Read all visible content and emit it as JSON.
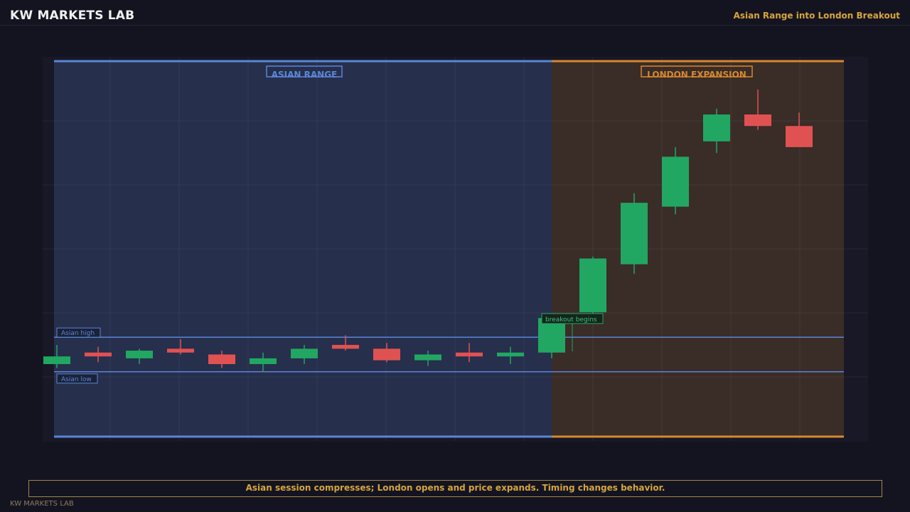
{
  "header": {
    "brand": "KW MARKETS LAB",
    "subtitle": "Asian Range into London Breakout"
  },
  "caption": "Asian session compresses; London opens and price expands. Timing changes behavior.",
  "footer": "KW MARKETS LAB",
  "colors": {
    "background": "#141421",
    "up": "#22a762",
    "down": "#e05252",
    "asian": "#5b86d6",
    "london": "#d6882e",
    "accent_text": "#d6a63c"
  },
  "chart_data": {
    "type": "candlestick",
    "title": "",
    "xlabel": "",
    "ylabel": "",
    "ylim": [
      0,
      10
    ],
    "grid": true,
    "zones": [
      {
        "name": "asian",
        "label": "ASIAN RANGE",
        "start": 0,
        "end": 12
      },
      {
        "name": "london",
        "label": "LONDON EXPANSION",
        "start": 12,
        "end": 19
      }
    ],
    "levels": [
      {
        "name": "asian-high",
        "label": "Asian high",
        "value": 2.7
      },
      {
        "name": "asian-low",
        "label": "Asian low",
        "value": 1.8
      }
    ],
    "annotations": [
      {
        "name": "breakout-label",
        "text": "breakout begins",
        "x": 13
      }
    ],
    "candles": [
      {
        "o": 2.0,
        "h": 2.5,
        "l": 1.9,
        "c": 2.2
      },
      {
        "o": 2.3,
        "h": 2.45,
        "l": 2.05,
        "c": 2.2
      },
      {
        "o": 2.15,
        "h": 2.4,
        "l": 2.0,
        "c": 2.35
      },
      {
        "o": 2.4,
        "h": 2.65,
        "l": 2.25,
        "c": 2.3
      },
      {
        "o": 2.25,
        "h": 2.35,
        "l": 1.9,
        "c": 2.0
      },
      {
        "o": 2.0,
        "h": 2.3,
        "l": 1.8,
        "c": 2.15
      },
      {
        "o": 2.15,
        "h": 2.5,
        "l": 2.0,
        "c": 2.4
      },
      {
        "o": 2.5,
        "h": 2.75,
        "l": 2.35,
        "c": 2.4
      },
      {
        "o": 2.4,
        "h": 2.55,
        "l": 2.05,
        "c": 2.1
      },
      {
        "o": 2.1,
        "h": 2.35,
        "l": 1.95,
        "c": 2.25
      },
      {
        "o": 2.3,
        "h": 2.55,
        "l": 2.05,
        "c": 2.2
      },
      {
        "o": 2.2,
        "h": 2.45,
        "l": 2.0,
        "c": 2.3
      },
      {
        "o": 2.3,
        "h": 3.25,
        "l": 2.15,
        "c": 3.2
      },
      {
        "o": 3.35,
        "h": 4.8,
        "l": 3.2,
        "c": 4.75
      },
      {
        "o": 4.6,
        "h": 6.45,
        "l": 4.35,
        "c": 6.2
      },
      {
        "o": 6.1,
        "h": 7.65,
        "l": 5.9,
        "c": 7.4
      },
      {
        "o": 7.8,
        "h": 8.65,
        "l": 7.5,
        "c": 8.5
      },
      {
        "o": 8.5,
        "h": 9.15,
        "l": 8.1,
        "c": 8.2
      },
      {
        "o": 8.2,
        "h": 8.55,
        "l": 7.8,
        "c": 7.65
      }
    ]
  }
}
